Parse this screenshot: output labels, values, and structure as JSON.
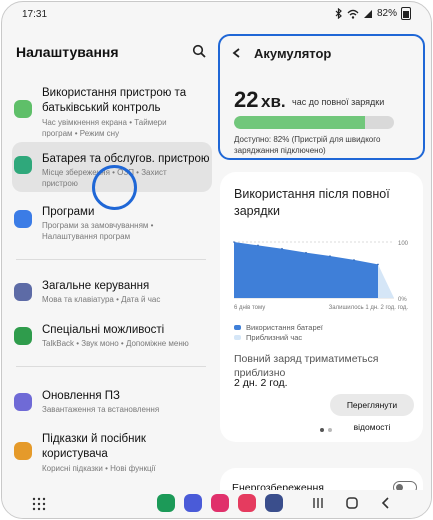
{
  "status": {
    "time": "17:31",
    "battery_percent": "82%"
  },
  "left": {
    "title": "Налаштування",
    "items": [
      {
        "title": "Використання пристрою та батьківський контроль",
        "subtitle": "Час увімкнення екрана • Таймери програм • Режим сну",
        "icon": "device-care-icon",
        "color": "#5fbf69"
      },
      {
        "title": "Батарея та обслугов. пристрою",
        "subtitle": "Місце збереження • ОЗП • Захист пристрою",
        "icon": "battery-care-icon",
        "color": "#2fa87b"
      },
      {
        "title": "Програми",
        "subtitle": "Програми за замовчуванням • Налаштування програм",
        "icon": "apps-grid-icon",
        "color": "#3b7ce6"
      },
      {
        "title": "Загальне керування",
        "subtitle": "Мова та клавіатура • Дата й час",
        "icon": "sliders-icon",
        "color": "#5d6ba6"
      },
      {
        "title": "Спеціальні можливості",
        "subtitle": "TalkBack • Звук моно • Допоміжне меню",
        "icon": "accessibility-icon",
        "color": "#2f9c4c"
      },
      {
        "title": "Оновлення ПЗ",
        "subtitle": "Завантаження та встановлення",
        "icon": "update-icon",
        "color": "#6f6ad6"
      },
      {
        "title": "Підказки й посібник користувача",
        "subtitle": "Корисні підказки • Нові функції",
        "icon": "tips-icon",
        "color": "#e59a2a"
      }
    ]
  },
  "battery": {
    "header": "Акумулятор",
    "value": "22",
    "unit": "хв.",
    "desc": "час до повної зарядки",
    "level": 0.82,
    "available": "Доступно: 82% (Пристрій для швидкого заряджання підключено)"
  },
  "usage": {
    "title": "Використання після повної зарядки",
    "x_left": "6 днів тому",
    "x_right": "Залишилось 1 дн. 2 год. год.",
    "y_top": "100",
    "y_bottom": "0%",
    "legend_used": "Використання батареї",
    "legend_est": "Приблизний час",
    "full_text": "Повний заряд триматиметься приблизно",
    "duration": "2 дн. 2 год.",
    "details_button": "Переглянути відомості",
    "colors": {
      "used": "#3f7fd8",
      "estimate": "#d5e6f7"
    }
  },
  "power": {
    "label": "Енергозбереження"
  },
  "chart_data": {
    "type": "area",
    "x": [
      "6 днів тому",
      "",
      "",
      "",
      "",
      "",
      "Залишилось 1 дн. 2 год."
    ],
    "series": [
      {
        "name": "Використання батареї",
        "values": [
          100,
          94,
          88,
          81,
          75,
          68,
          60
        ]
      }
    ],
    "ylim": [
      0,
      100
    ],
    "ytick_labels": [
      "100",
      "0%"
    ]
  },
  "dock": {
    "apps_icon": "apps-grid-icon",
    "apps": [
      {
        "name": "phone-app-icon",
        "color": "#1c9a58"
      },
      {
        "name": "messages-app-icon",
        "color": "#4a5bd8"
      },
      {
        "name": "bixby-app-icon",
        "color": "#e0306b"
      },
      {
        "name": "camera-app-icon",
        "color": "#e53b5f"
      },
      {
        "name": "settings-app-icon",
        "color": "#3a4e8c"
      }
    ]
  }
}
